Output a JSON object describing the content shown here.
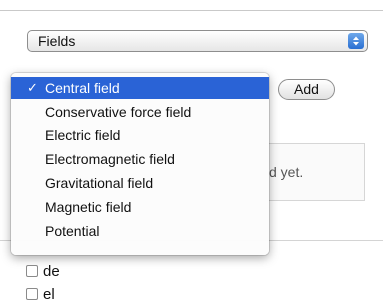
{
  "fields_select": {
    "value": "Fields"
  },
  "add_button": {
    "label": "Add"
  },
  "background_box": {
    "text": "d yet."
  },
  "menu": {
    "items": [
      {
        "label": "Central field",
        "selected": true
      },
      {
        "label": "Conservative force field",
        "selected": false
      },
      {
        "label": "Electric field",
        "selected": false
      },
      {
        "label": "Electromagnetic field",
        "selected": false
      },
      {
        "label": "Gravitational field",
        "selected": false
      },
      {
        "label": "Magnetic field",
        "selected": false
      },
      {
        "label": "Potential",
        "selected": false
      }
    ],
    "check_glyph": "✓"
  },
  "checkbox_list": [
    {
      "label": "de",
      "checked": false
    },
    {
      "label": "el",
      "checked": false
    }
  ],
  "colors": {
    "selection": "#2a63d6",
    "stepper": "#3d7fe0"
  }
}
